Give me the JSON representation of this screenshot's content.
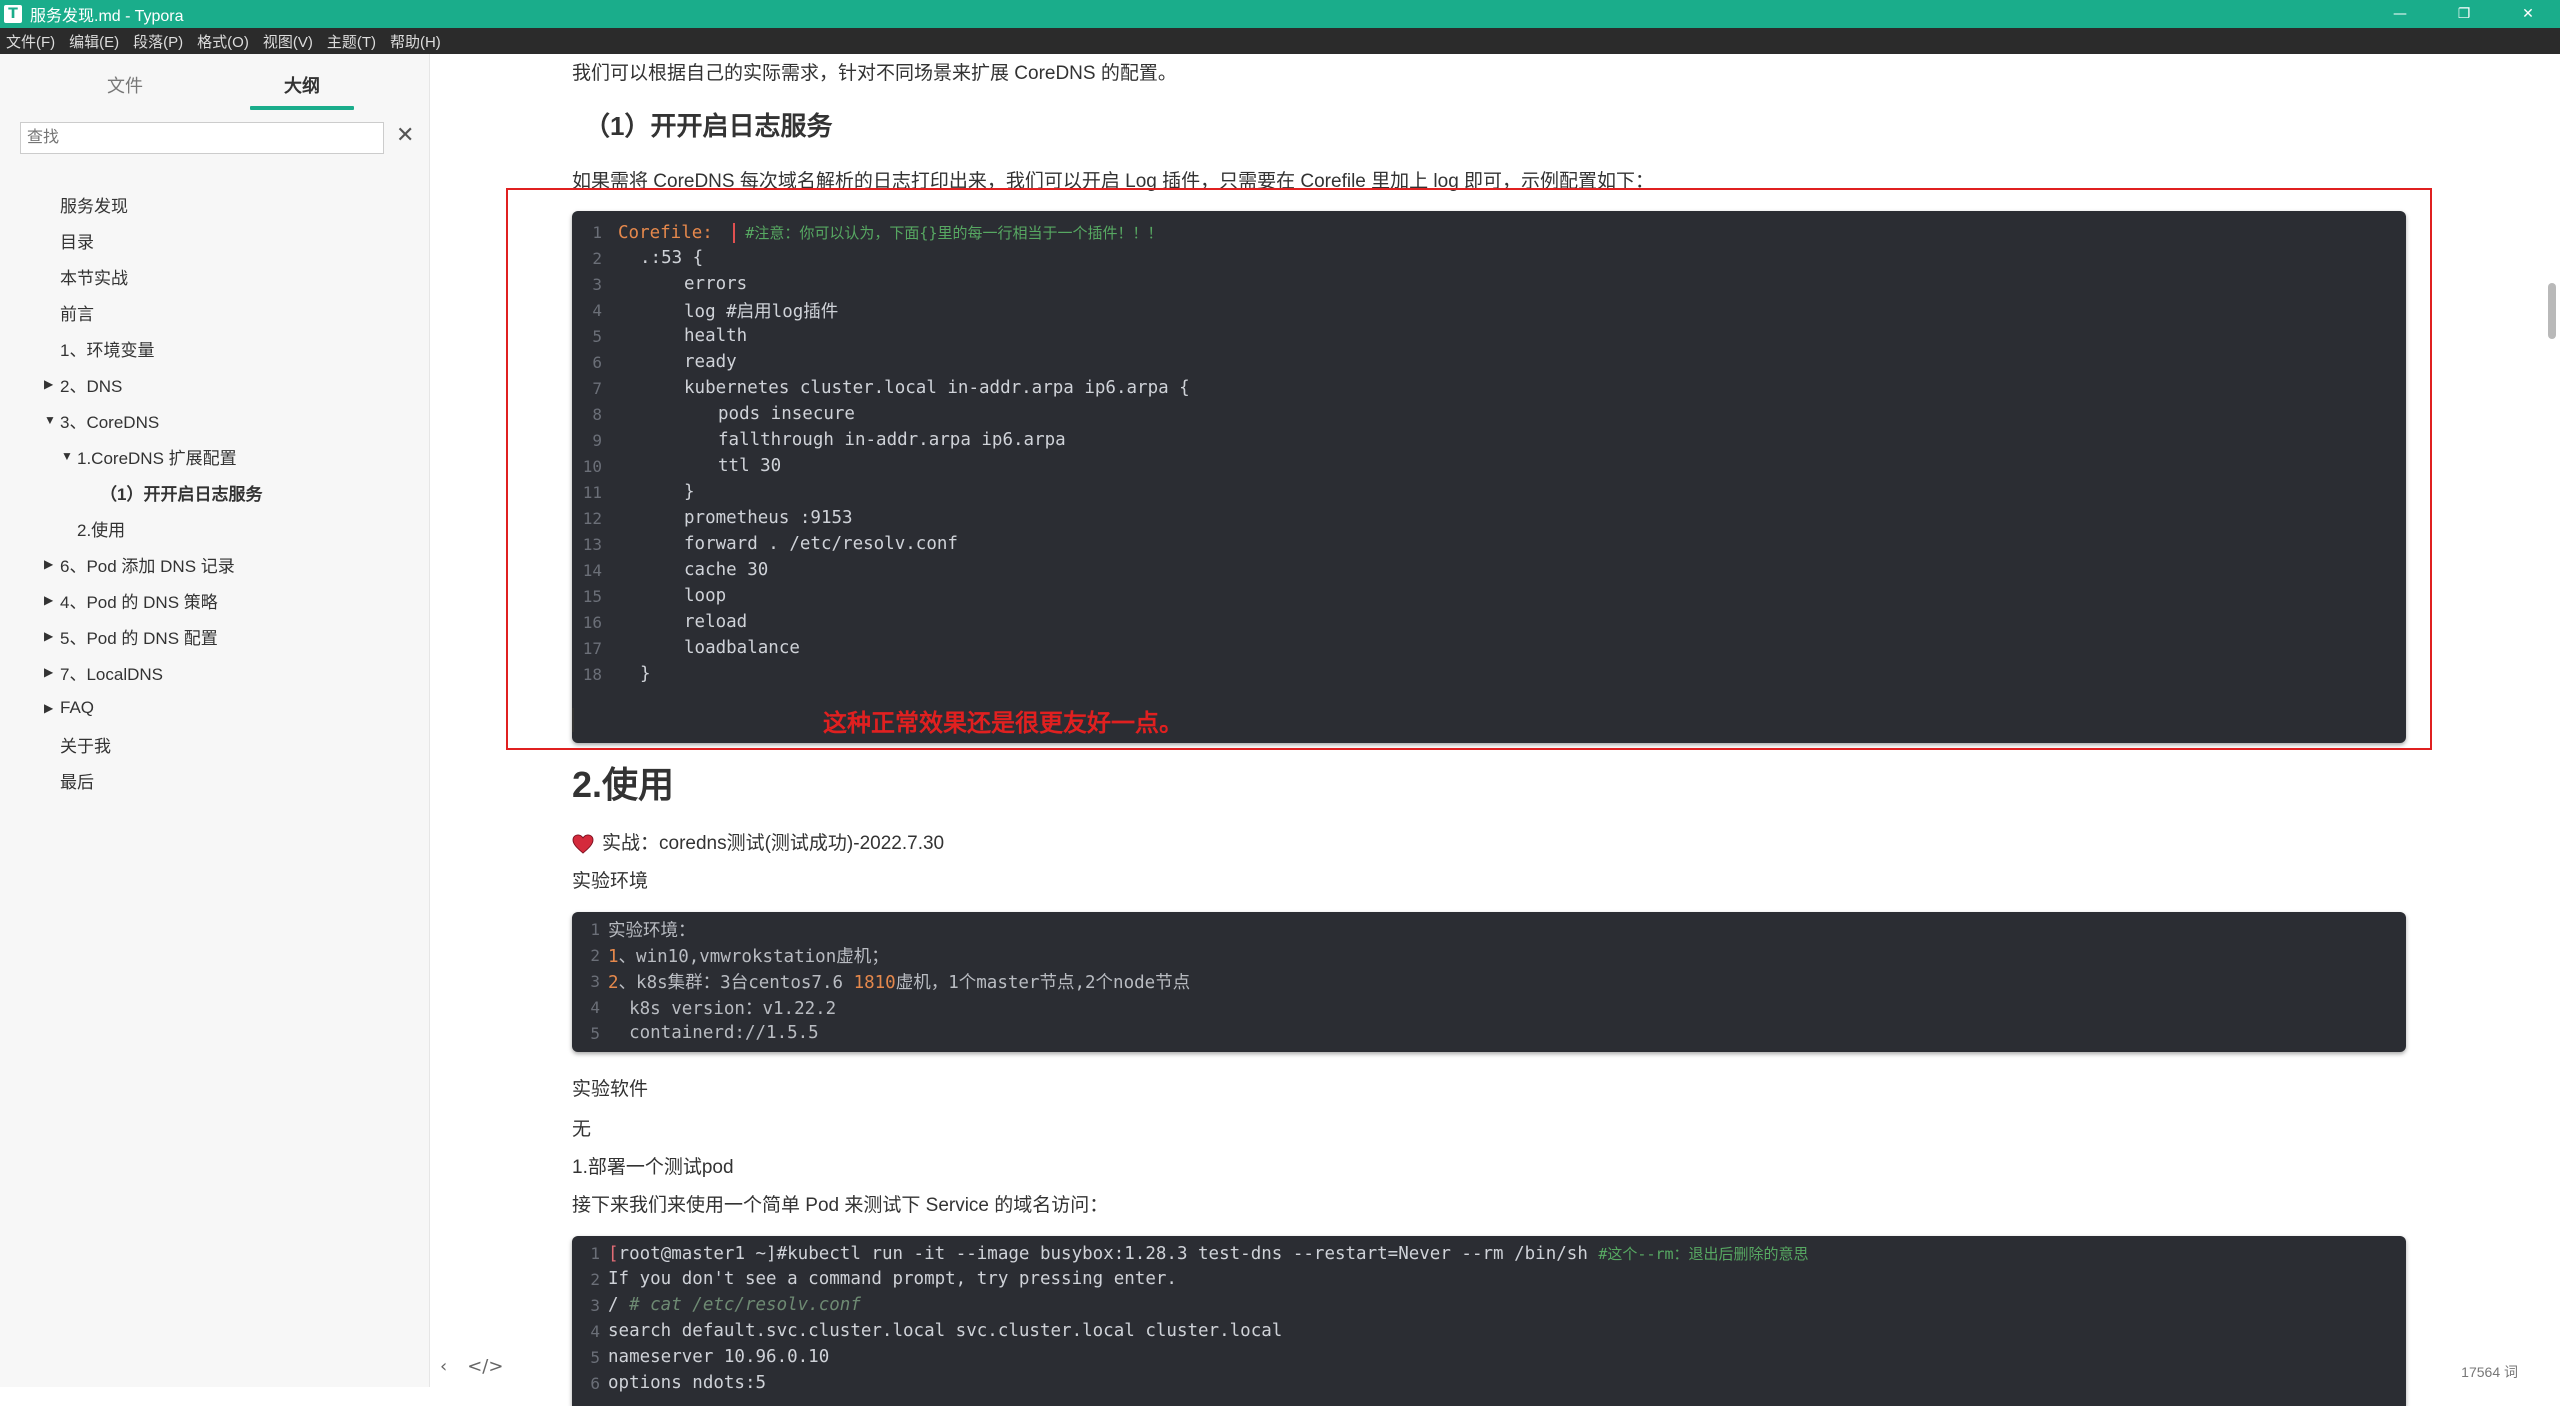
{
  "window": {
    "title": "服务发现.md - Typora",
    "app_icon": "T",
    "controls": {
      "minimize": "—",
      "maximize": "❐",
      "close": "✕"
    }
  },
  "menu": [
    "文件(F)",
    "编辑(E)",
    "段落(P)",
    "格式(O)",
    "视图(V)",
    "主题(T)",
    "帮助(H)"
  ],
  "sidebar": {
    "tabs": {
      "files": "文件",
      "outline": "大纲"
    },
    "search_placeholder": "查找",
    "search_clear": "✕",
    "outline": [
      {
        "label": "服务发现",
        "arrow": ""
      },
      {
        "label": "目录",
        "arrow": ""
      },
      {
        "label": "本节实战",
        "arrow": ""
      },
      {
        "label": "前言",
        "arrow": ""
      },
      {
        "label": "1、环境变量",
        "arrow": ""
      },
      {
        "label": "2、DNS",
        "arrow": "▶"
      },
      {
        "label": "3、CoreDNS",
        "arrow": "▼"
      },
      {
        "label": "1.CoreDNS 扩展配置",
        "arrow": "▼"
      },
      {
        "label": "（1）开开启日志服务",
        "arrow": ""
      },
      {
        "label": "2.使用",
        "arrow": ""
      },
      {
        "label": "6、Pod 添加 DNS 记录",
        "arrow": "▶"
      },
      {
        "label": "4、Pod 的 DNS 策略",
        "arrow": "▶"
      },
      {
        "label": "5、Pod 的 DNS 配置",
        "arrow": "▶"
      },
      {
        "label": "7、LocalDNS",
        "arrow": "▶"
      },
      {
        "label": "FAQ",
        "arrow": "▶"
      },
      {
        "label": "关于我",
        "arrow": ""
      },
      {
        "label": "最后",
        "arrow": ""
      }
    ]
  },
  "content": {
    "intro": "我们可以根据自己的实际需求，针对不同场景来扩展 CoreDNS 的配置。",
    "h3": "（1）开开启日志服务",
    "log_desc": "如果需将 CoreDNS 每次域名解析的日志打印出来，我们可以开启 Log 插件，只需要在 Corefile 里加上 log 即可，示例配置如下：",
    "code1": {
      "corefile_key": "Corefile:",
      "corefile_comment": "#注意：你可以认为，下面{}里的每一行相当于一个插件！！！",
      "lines": [
        ".:53 {",
        "errors",
        "log #启用log插件",
        "health",
        "ready",
        "kubernetes cluster.local in-addr.arpa ip6.arpa {",
        "pods insecure",
        "fallthrough in-addr.arpa ip6.arpa",
        "ttl 30",
        "}",
        "prometheus :9153",
        "forward . /etc/resolv.conf",
        "cache 30",
        "loop",
        "reload",
        "loadbalance",
        "}"
      ]
    },
    "annotation": "这种正常效果还是很更友好一点。",
    "h2": "2.使用",
    "practice": "实战：coredns测试(测试成功)-2022.7.30",
    "env_label": "实验环境",
    "code2": {
      "l1": "实验环境：",
      "l2": "、win10,vmwrokstation虚机；",
      "l3a": "、k8s集群：3台centos7.6 ",
      "l3b": "1810",
      "l3c": "虚机，1个master节点,2个node节点",
      "l4": "  k8s version：v1.22.2",
      "l5": "  containerd://1.5.5",
      "n1": "1",
      "n2": "2"
    },
    "software_label": "实验软件",
    "none": "无",
    "deploy": "1.部署一个测试pod",
    "next_desc": "接下来我们来使用一个简单 Pod 来测试下 Service 的域名访问：",
    "code3": {
      "l1a": "[",
      "l1b": "root@master1 ~]#kubectl run -it --image busybox:1.28.3 test-dns --restart=Never --rm /bin/sh ",
      "l1c": "#这个--rm：退出后删除的意思",
      "l2": "If you don't see a command prompt, try pressing enter.",
      "l3a": "/ ",
      "l3b": "# cat /etc/resolv.conf",
      "l4": "search default.svc.cluster.local svc.cluster.local cluster.local",
      "l5": "nameserver 10.96.0.10",
      "l6": "options ndots:5"
    }
  },
  "footer": {
    "word_count": "17564 词",
    "back": "‹",
    "source": "</>"
  },
  "colors": {
    "accent": "#1aad8b",
    "code_bg": "#2b2d33",
    "annotation": "#e02020"
  }
}
